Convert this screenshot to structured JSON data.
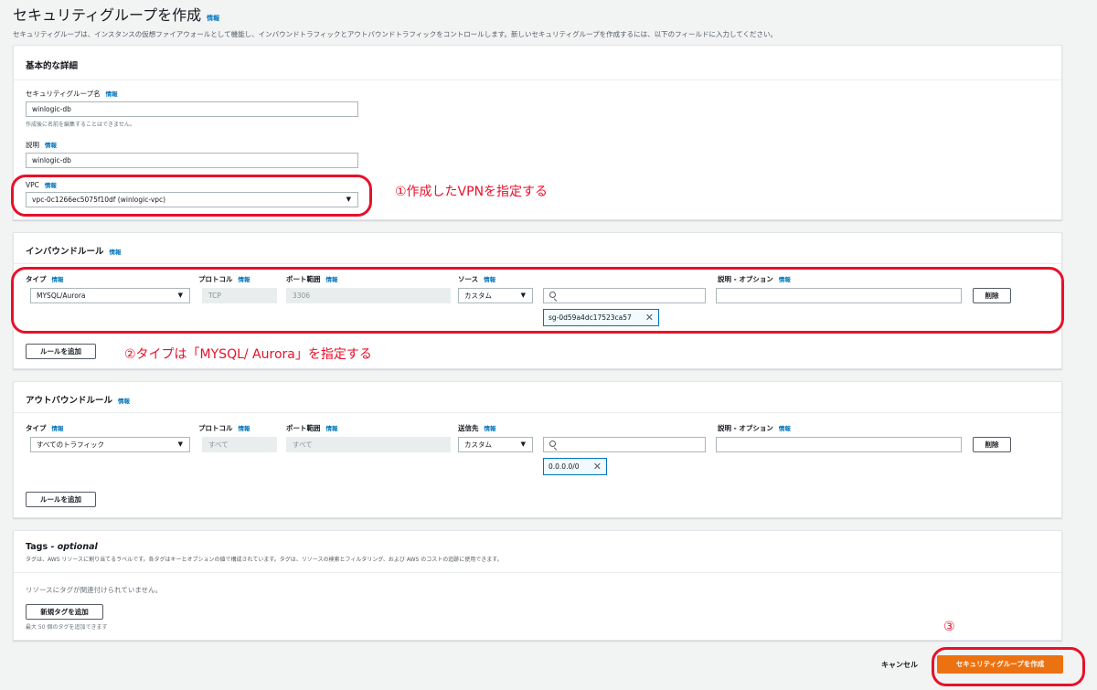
{
  "page": {
    "title": "セキュリティグループを作成",
    "title_info": "情報",
    "description": "セキュリティグループは、インスタンスの仮想ファイアウォールとして機能し、インバウンドトラフィックとアウトバウンドトラフィックをコントロールします。新しいセキュリティグループを作成するには、以下のフィールドに入力してください。"
  },
  "basic": {
    "heading": "基本的な詳細",
    "name_label": "セキュリティグループ名",
    "name_info": "情報",
    "name_value": "winlogic-db",
    "name_hint": "作成後に名前を編集することはできません。",
    "desc_label": "説明",
    "desc_info": "情報",
    "desc_value": "winlogic-db",
    "vpc_label": "VPC",
    "vpc_info": "情報",
    "vpc_value": "vpc-0c1266ec5075f10df (winlogic-vpc)"
  },
  "inbound": {
    "heading": "インバウンドルール",
    "heading_info": "情報",
    "col_type": "タイプ",
    "col_protocol": "プロトコル",
    "col_port": "ポート範囲",
    "col_source": "ソース",
    "col_desc": "説明 - オプション",
    "info": "情報",
    "type_value": "MYSQL/Aurora",
    "protocol_value": "TCP",
    "port_value": "3306",
    "source_value": "カスタム",
    "token": "sg-0d59a4dc17523ca57",
    "delete": "削除",
    "add_rule": "ルールを追加"
  },
  "outbound": {
    "heading": "アウトバウンドルール",
    "heading_info": "情報",
    "col_type": "タイプ",
    "col_protocol": "プロトコル",
    "col_port": "ポート範囲",
    "col_dest": "送信先",
    "col_desc": "説明 - オプション",
    "info": "情報",
    "type_value": "すべてのトラフィック",
    "protocol_value": "すべて",
    "port_value": "すべて",
    "dest_value": "カスタム",
    "token": "0.0.0.0/0",
    "delete": "削除",
    "add_rule": "ルールを追加"
  },
  "tags": {
    "heading": "Tags - ",
    "heading_italic": "optional",
    "description": "タグは、AWS リソースに割り当てるラベルです。各タグはキーとオプションの値で構成されています。タグは、リソースの検索とフィルタリング、および AWS のコストの追跡に使用できます。",
    "empty": "リソースにタグが関連付けられていません。",
    "add_tag": "新規タグを追加",
    "limit_hint": "最大 50 個のタグを追加できます"
  },
  "footer": {
    "cancel": "キャンセル",
    "create": "セキュリティグループを作成"
  },
  "annotations": {
    "a1": "①作成したVPNを指定する",
    "a2": "②タイプは「MYSQL/ Aurora」を指定する",
    "a3": "③"
  },
  "icons": {
    "dropdown": "▼",
    "remove": "✕",
    "search": "search-icon"
  },
  "colors": {
    "accent_orange": "#ec7211",
    "link_blue": "#0073bb",
    "annotation_red": "#e8102a"
  }
}
